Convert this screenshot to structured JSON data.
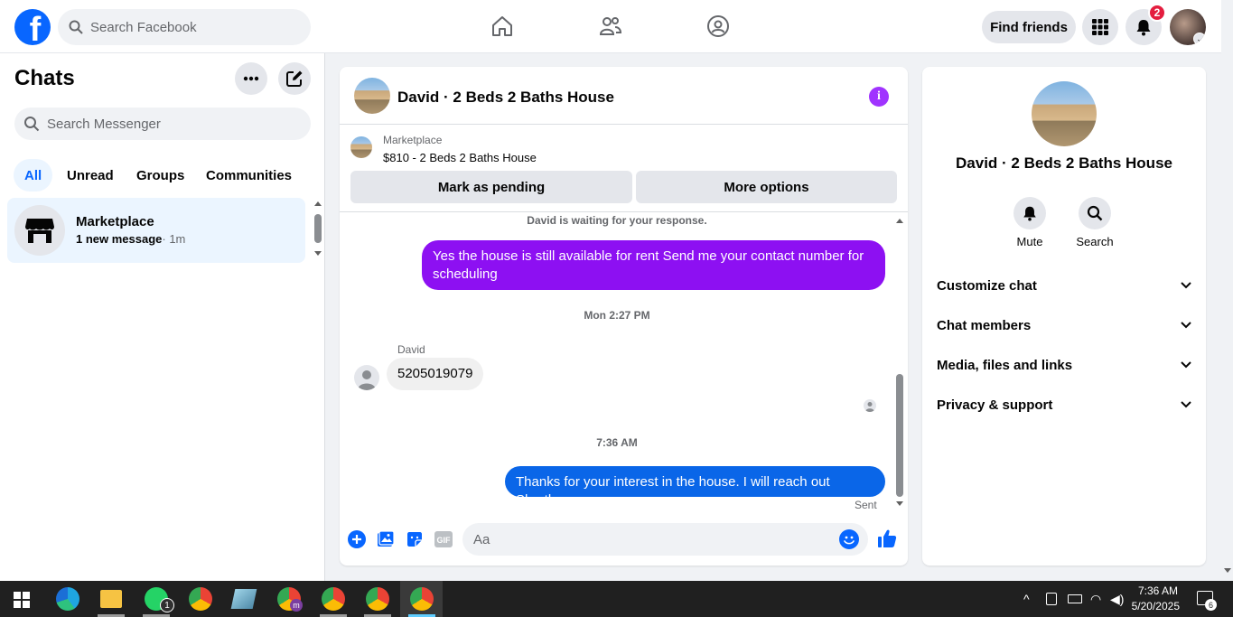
{
  "topbar": {
    "logo_letter": "f",
    "search_placeholder": "Search Facebook",
    "find_friends_label": "Find friends",
    "notification_count": "2"
  },
  "left": {
    "title": "Chats",
    "search_placeholder": "Search Messenger",
    "filters": [
      "All",
      "Unread",
      "Groups",
      "Communities"
    ],
    "active_filter": "All",
    "chat_items": [
      {
        "name": "Marketplace",
        "preview": "1 new message",
        "time": "· 1m"
      }
    ]
  },
  "conversation": {
    "title": "David · 2 Beds 2 Baths House",
    "marketplace_label": "Marketplace",
    "listing": "$810 - 2 Beds 2 Baths House",
    "mark_pending_label": "Mark as pending",
    "more_options_label": "More options",
    "waiting_notice": "David is waiting for your response.",
    "messages": {
      "outgoing_1": "Yes the house is still available for rent Send me your contact number for scheduling",
      "timestamp_1": "Mon 2:27 PM",
      "sender_name": "David",
      "incoming_1": "5205019079",
      "timestamp_2": "7:36 AM",
      "outgoing_2": "Thanks for your interest in the house. I will reach out Shortly",
      "status": "Sent"
    },
    "composer_placeholder": "Aa",
    "gif_label": "GIF"
  },
  "right": {
    "title": "David · 2 Beds 2 Baths House",
    "actions": [
      "Mute",
      "Search"
    ],
    "sections": [
      "Customize chat",
      "Chat members",
      "Media, files and links",
      "Privacy & support"
    ]
  },
  "taskbar": {
    "time": "7:36 AM",
    "date": "5/20/2025",
    "whatsapp_badge": "1",
    "notification_badge": "6",
    "chrome_profile_letter": "m"
  },
  "colors": {
    "brand": "#0866ff",
    "purple_bubble": "#8d10f2",
    "blue_bubble": "#0a66e8",
    "badge_red": "#e41e3f"
  }
}
